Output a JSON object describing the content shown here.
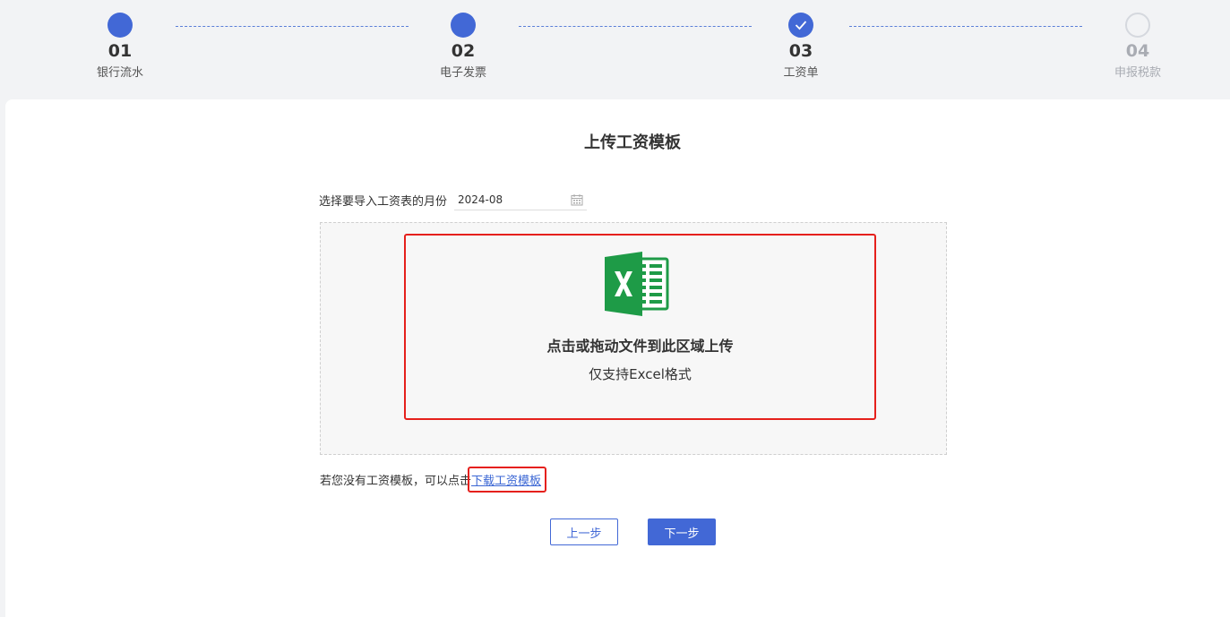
{
  "steps": [
    {
      "num": "01",
      "label": "银行流水",
      "state": "done"
    },
    {
      "num": "02",
      "label": "电子发票",
      "state": "done"
    },
    {
      "num": "03",
      "label": "工资单",
      "state": "current"
    },
    {
      "num": "04",
      "label": "申报税款",
      "state": "pending"
    }
  ],
  "page": {
    "title": "上传工资模板",
    "month_label": "选择要导入工资表的月份",
    "month_value": "2024-08"
  },
  "upload": {
    "main_text": "点击或拖动文件到此区域上传",
    "sub_text": "仅支持Excel格式"
  },
  "tip": {
    "prefix": "若您没有工资模板，可以点击",
    "link": "下载工资模板"
  },
  "buttons": {
    "prev": "上一步",
    "next": "下一步"
  },
  "colors": {
    "accent": "#4268d6",
    "excel_green": "#1e9b47",
    "highlight_red": "#e5201c"
  }
}
